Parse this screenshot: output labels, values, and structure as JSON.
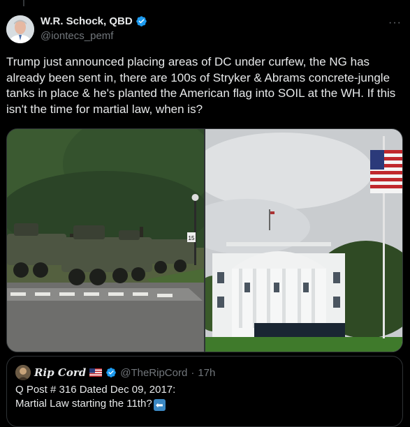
{
  "tweet": {
    "author_name": "W.R. Schock, QBD",
    "author_handle": "@iontecs_pemf",
    "more_label": "···",
    "text": "Trump just announced placing areas of DC under curfew, the NG has already been sent in, there are 100s of Stryker & Abrams concrete-jungle tanks in place & he's planted the American flag into SOIL at the WH. If this isn't the time for martial law, when is?",
    "media": [
      {
        "icon": "photo-military-vehicles"
      },
      {
        "icon": "photo-white-house-flag"
      }
    ]
  },
  "sign": {
    "label": "15"
  },
  "quote": {
    "author_name": "Rip Cord",
    "flag_icon": "us-flag-emoji",
    "author_handle": "@TheRipCord",
    "separator": "·",
    "time": "17h",
    "line1": "Q Post # 316 Dated Dec 09, 2017:",
    "line2": "Martial Law starting the 11th?",
    "line2_icon": "left-arrow-emoji"
  },
  "colors": {
    "background": "#000000",
    "text": "#e7e9ea",
    "muted": "#71767b",
    "verified_blue": "#1d9bf0",
    "border": "#2f3336"
  }
}
